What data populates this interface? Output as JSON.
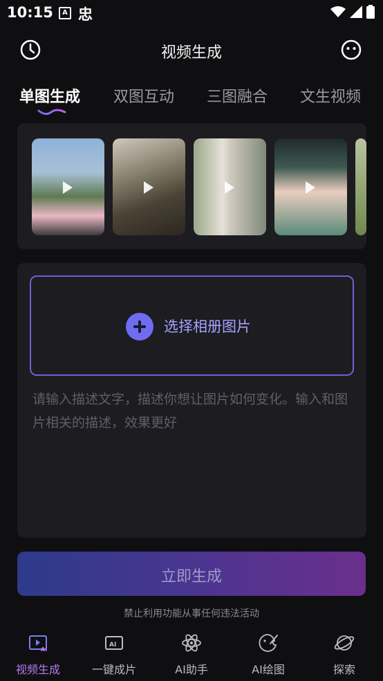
{
  "status": {
    "time": "10:15",
    "notif_a": "A",
    "notif_cn": "忠"
  },
  "header": {
    "title": "视频生成"
  },
  "tabs": [
    {
      "label": "单图生成",
      "active": true
    },
    {
      "label": "双图互动"
    },
    {
      "label": "三图融合"
    },
    {
      "label": "文生视频"
    }
  ],
  "upload": {
    "label": "选择相册图片"
  },
  "prompt": {
    "placeholder": "请输入描述文字，描述你想让图片如何变化。输入和图片相关的描述，效果更好"
  },
  "actions": {
    "generate_label": "立即生成"
  },
  "disclaimer": "禁止利用功能从事任何违法活动",
  "nav": [
    {
      "label": "视频生成",
      "icon": "video-ai-icon",
      "active": true
    },
    {
      "label": "一键成片",
      "icon": "ai-film-icon"
    },
    {
      "label": "AI助手",
      "icon": "atom-icon"
    },
    {
      "label": "AI绘图",
      "icon": "paint-icon"
    },
    {
      "label": "探索",
      "icon": "planet-icon"
    }
  ],
  "colors": {
    "accent": "#6f6cf2",
    "nav_active": "#b27cf2",
    "bg": "#0f0f12",
    "card": "#1c1c21"
  }
}
